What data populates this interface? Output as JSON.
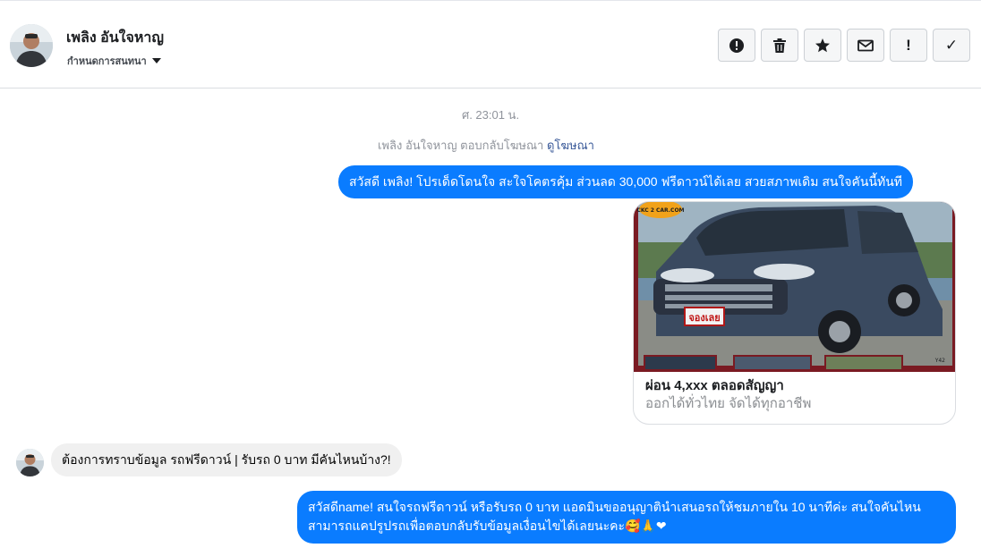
{
  "contact": {
    "name": "เพลิง อันใจหาญ",
    "assign_label": "กำหนดการสนทนา"
  },
  "actions": [
    {
      "name": "mark-spam-button",
      "icon": "alert-circle-icon"
    },
    {
      "name": "delete-button",
      "icon": "trash-icon"
    },
    {
      "name": "star-button",
      "icon": "star-icon"
    },
    {
      "name": "mark-unread-button",
      "icon": "envelope-icon"
    },
    {
      "name": "follow-up-button",
      "icon": "exclamation-icon",
      "glyph": "!"
    },
    {
      "name": "mark-done-button",
      "icon": "check-icon",
      "glyph": "✓"
    }
  ],
  "conversation": {
    "timestamp": "ศ. 23:01 น.",
    "system_text": "เพลิง อันใจหาญ ตอบกลับโฆษณา",
    "system_link": "ดูโฆษณา",
    "messages": [
      {
        "from": "page",
        "text": "สวัสดี เพลิง! โปรเด็ดโดนใจ สะใจโคตรคุ้ม ส่วนลด 30,000 ฟรีดาวน์ได้เลย สวยสภาพเดิม สนใจคันนี้ทันที"
      },
      {
        "from": "user",
        "text": "ต้องการทราบข้อมูล รถฟรีดาวน์ | รับรถ 0 บาท มีคันไหนบ้าง?!"
      },
      {
        "from": "page",
        "text": "สวัสดีname! สนใจรถฟรีดาวน์ หรือรับรถ 0 บาท แอดมินขออนุญาตินำเสนอรถให้ชมภายใน 10 นาทีค่ะ สนใจคันไหนสามารถแคปรูปรถเพื่อตอบกลับรับข้อมูลเงื่อนไขได้เลยนะคะ",
        "emoji": "🥰🙏❤"
      }
    ],
    "ad": {
      "title": "ผ่อน 4,xxx ตลอดสัญญา",
      "description": "ออกได้ทั่วไทย จัดได้ทุกอาชีพ",
      "image": {
        "logo_text": "CKC 2 CAR.COM",
        "sticker_text": "จองเลย",
        "corner_text": "Y42"
      }
    }
  },
  "colors": {
    "outgoing_bubble": "#0a7cff",
    "incoming_bubble": "#f0f0f0",
    "link": "#385898",
    "muted": "#90949c"
  }
}
